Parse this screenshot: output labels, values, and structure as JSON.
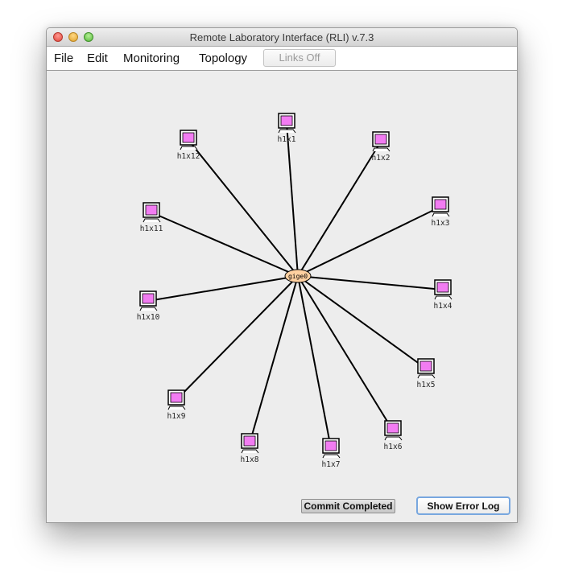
{
  "window": {
    "title": "Remote Laboratory Interface (RLI) v.7.3",
    "controls": [
      "close",
      "minimize",
      "maximize"
    ]
  },
  "menubar": {
    "items": [
      {
        "label": "File"
      },
      {
        "label": "Edit"
      },
      {
        "label": "Monitoring"
      },
      {
        "label": "Topology"
      }
    ],
    "links_toggle": {
      "label": "Links Off",
      "enabled": false
    }
  },
  "topology": {
    "hub": {
      "label": "gige0",
      "color": "#ffd0a0"
    },
    "host_screen_color": "#f27cf2",
    "hosts": [
      {
        "label": "h1x1"
      },
      {
        "label": "h1x2"
      },
      {
        "label": "h1x3"
      },
      {
        "label": "h1x4"
      },
      {
        "label": "h1x5"
      },
      {
        "label": "h1x6"
      },
      {
        "label": "h1x7"
      },
      {
        "label": "h1x8"
      },
      {
        "label": "h1x9"
      },
      {
        "label": "h1x10"
      },
      {
        "label": "h1x11"
      },
      {
        "label": "h1x12"
      }
    ]
  },
  "footer": {
    "commit_label": "Commit Completed",
    "error_log_label": "Show Error Log"
  }
}
